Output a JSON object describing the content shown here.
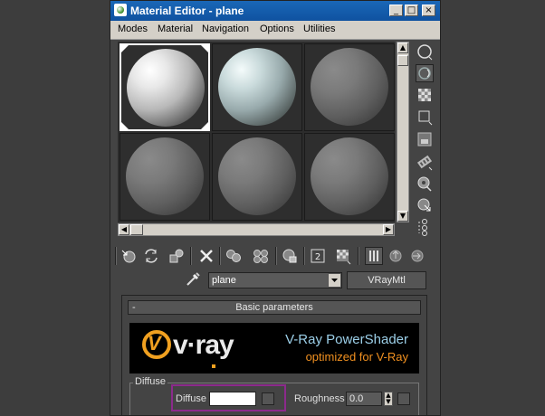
{
  "window": {
    "title": "Material Editor - plane",
    "minimize": "_",
    "maximize": "□",
    "close": "×"
  },
  "menu": [
    "Modes",
    "Material",
    "Navigation",
    "Options",
    "Utilities"
  ],
  "material": {
    "name": "plane",
    "type_button": "VRayMtl"
  },
  "rollout": {
    "title": "Basic parameters",
    "collapse_symbol": "-",
    "banner": {
      "logo_text": "v·ray",
      "line1": "V-Ray PowerShader",
      "line2": "optimized for V-Ray",
      "accent_color": "#f0a020",
      "line1_color": "#9ccfe8",
      "line2_color": "#f09020"
    },
    "diffuse_group": {
      "label": "Diffuse",
      "diffuse_label": "Diffuse",
      "diffuse_color": "#ffffff",
      "roughness_label": "Roughness",
      "roughness_value": "0.0"
    }
  },
  "slots": [
    {
      "name": "sample-slot-1",
      "sphere": "white",
      "selected": true
    },
    {
      "name": "sample-slot-2",
      "sphere": "teal",
      "selected": false
    },
    {
      "name": "sample-slot-3",
      "sphere": "grey",
      "selected": false
    },
    {
      "name": "sample-slot-4",
      "sphere": "grey",
      "selected": false
    },
    {
      "name": "sample-slot-5",
      "sphere": "grey",
      "selected": false
    },
    {
      "name": "sample-slot-6",
      "sphere": "grey",
      "selected": false
    }
  ],
  "right_tools": [
    "sample-type-sphere-icon",
    "backlight-icon",
    "background-checker-icon",
    "sample-uv-tiling-icon",
    "video-color-check-icon",
    "make-preview-icon",
    "options-icon",
    "select-by-material-icon",
    "material-map-navigator-icon"
  ],
  "bottom_tools": [
    "get-material-icon",
    "put-to-scene-icon",
    "assign-to-selection-icon",
    "reset-map-icon",
    "make-copy-icon",
    "make-unique-icon",
    "put-to-library-icon",
    "material-id-channel-icon",
    "show-map-in-viewport-icon",
    "show-end-result-icon",
    "go-to-parent-icon",
    "go-forward-to-sibling-icon"
  ]
}
